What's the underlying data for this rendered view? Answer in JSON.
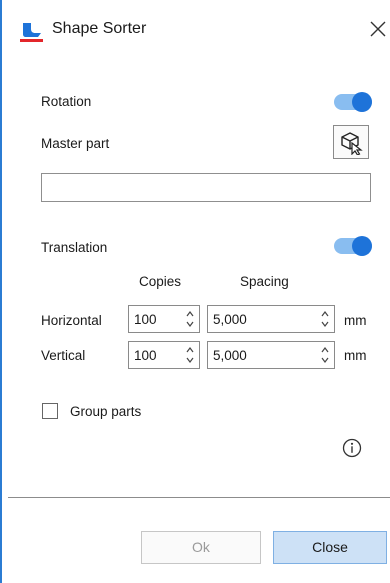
{
  "dialog": {
    "title": "Shape Sorter"
  },
  "rotation": {
    "label": "Rotation",
    "enabled": true
  },
  "master_part": {
    "label": "Master part",
    "value": ""
  },
  "translation": {
    "label": "Translation",
    "enabled": true,
    "copies_header": "Copies",
    "spacing_header": "Spacing",
    "horizontal": {
      "label": "Horizontal",
      "copies": "100",
      "spacing": "5,000",
      "unit": "mm"
    },
    "vertical": {
      "label": "Vertical",
      "copies": "100",
      "spacing": "5,000",
      "unit": "mm"
    }
  },
  "group_parts": {
    "label": "Group parts",
    "checked": false
  },
  "buttons": {
    "ok": "Ok",
    "close": "Close"
  },
  "colors": {
    "accent": "#1e73d9",
    "toggle_track": "#89bdf0",
    "close_button_bg": "#cde1f6"
  }
}
